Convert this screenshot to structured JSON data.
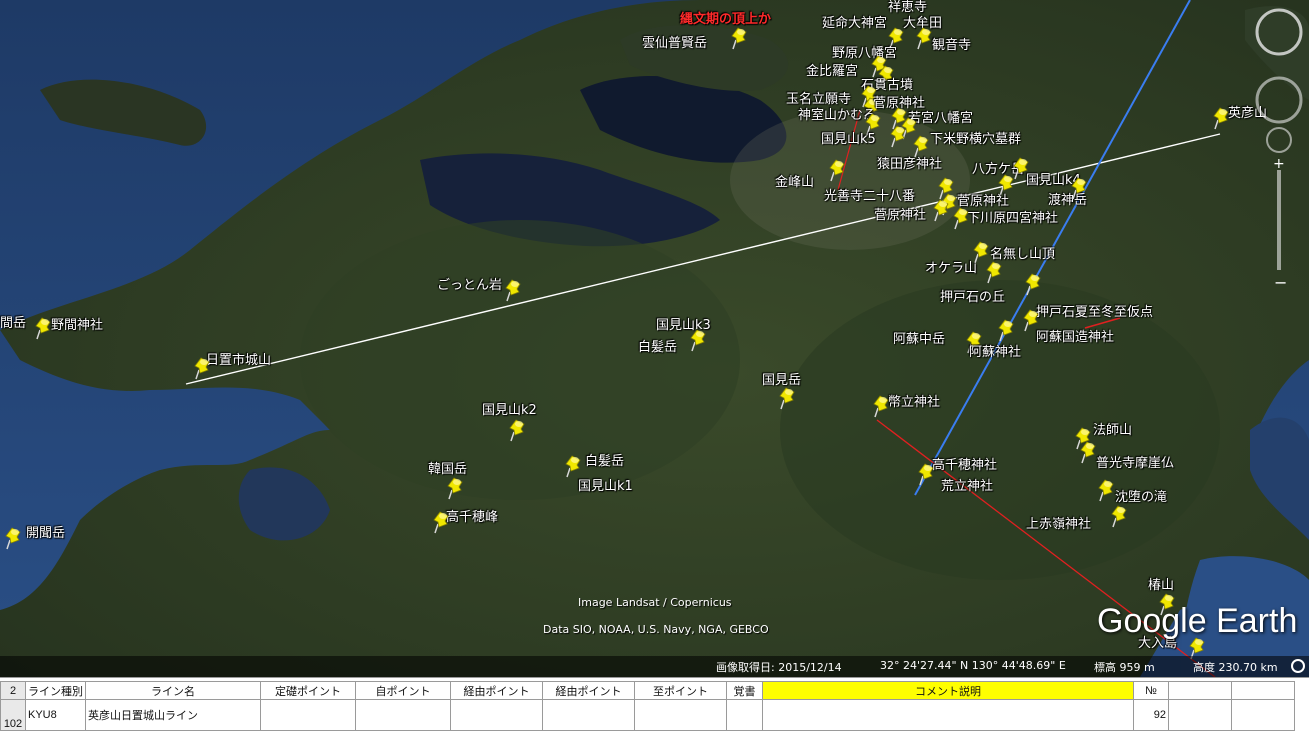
{
  "map": {
    "placemarks": [
      {
        "label": "縄文期の頂上か",
        "red": true
      },
      {
        "label": "雲仙普賢岳"
      },
      {
        "label": "祥恵寺"
      },
      {
        "label": "延命大神宮"
      },
      {
        "label": "大牟田"
      },
      {
        "label": "観音寺"
      },
      {
        "label": "野原八幡宮"
      },
      {
        "label": "金比羅宮"
      },
      {
        "label": "石貫古墳"
      },
      {
        "label": "玉名立願寺"
      },
      {
        "label": "菅原神社"
      },
      {
        "label": "神室山かむろ"
      },
      {
        "label": "若宮八幡宮"
      },
      {
        "label": "英彦山"
      },
      {
        "label": "国見山k5"
      },
      {
        "label": "下米野横穴墓群"
      },
      {
        "label": "猿田彦神社"
      },
      {
        "label": "八方ケ岳"
      },
      {
        "label": "金峰山"
      },
      {
        "label": "国見山k4"
      },
      {
        "label": "光善寺二十八番"
      },
      {
        "label": "菅原神社"
      },
      {
        "label": "渡神岳"
      },
      {
        "label": "菅原神社"
      },
      {
        "label": "下川原四宮神社"
      },
      {
        "label": "名無し山頂"
      },
      {
        "label": "オケラ山"
      },
      {
        "label": "ごっとん岩"
      },
      {
        "label": "押戸石の丘"
      },
      {
        "label": "押戸石夏至冬至仮点"
      },
      {
        "label": "野間神社"
      },
      {
        "label": "間岳"
      },
      {
        "label": "国見山k3"
      },
      {
        "label": "白髪岳"
      },
      {
        "label": "阿蘇中岳"
      },
      {
        "label": "阿蘇国造神社"
      },
      {
        "label": "阿蘇神社"
      },
      {
        "label": "日置市城山"
      },
      {
        "label": "国見岳"
      },
      {
        "label": "幣立神社"
      },
      {
        "label": "国見山k2"
      },
      {
        "label": "法師山"
      },
      {
        "label": "韓国岳"
      },
      {
        "label": "白髪岳"
      },
      {
        "label": "高千穂神社"
      },
      {
        "label": "普光寺摩崖仏"
      },
      {
        "label": "国見山k1"
      },
      {
        "label": "荒立神社"
      },
      {
        "label": "沈堕の滝"
      },
      {
        "label": "高千穂峰"
      },
      {
        "label": "上赤嶺神社"
      },
      {
        "label": "開聞岳"
      },
      {
        "label": "椿山"
      },
      {
        "label": "大入島"
      }
    ],
    "credits": {
      "landsat": "Image Landsat / Copernicus",
      "data": "Data SIO, NOAA, U.S. Navy, NGA, GEBCO"
    },
    "logo": "Google Earth",
    "status": {
      "date": "画像取得日: 2015/12/14",
      "coords": "32° 24'27.44\" N  130° 44'48.69\" E",
      "elevation": "標高   959 m",
      "altitude": "高度  230.70 km"
    },
    "line_colors": {
      "white": "#ffffff",
      "blue": "#3a7df0",
      "red": "#e02020"
    }
  },
  "sheet": {
    "row_numbers": [
      "2",
      "102"
    ],
    "headers": [
      "ライン種別",
      "ライン名",
      "定礎ポイント",
      "自ポイント",
      "経由ポイント",
      "経由ポイント",
      "至ポイント",
      "覚書",
      "コメント説明",
      "№"
    ],
    "row": {
      "type": "KYU8",
      "name": "英彦山日置城山ライン",
      "no": "92"
    }
  }
}
